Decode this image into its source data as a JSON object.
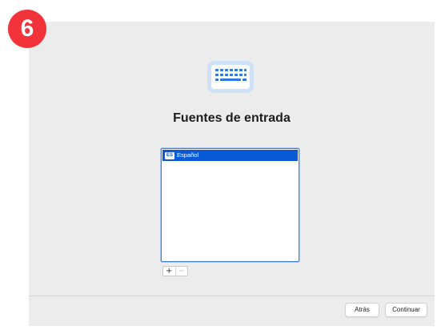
{
  "step_badge": {
    "number": "6",
    "color": "#f2343a"
  },
  "page": {
    "icon": "keyboard-icon",
    "title": "Fuentes de entrada"
  },
  "input_sources": {
    "items": [
      {
        "badge": "ES",
        "label": "Español",
        "selected": true
      }
    ],
    "add_label": "+",
    "remove_label": "−"
  },
  "footer": {
    "back_label": "Atrás",
    "continue_label": "Continuar"
  },
  "colors": {
    "accent": "#0a5ad7",
    "background": "#ececec"
  }
}
